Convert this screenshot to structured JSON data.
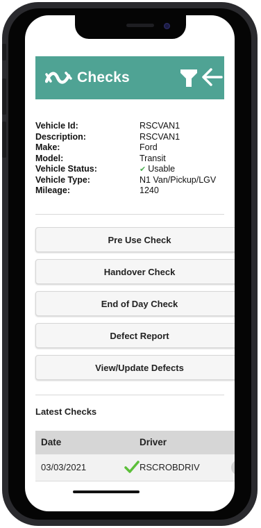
{
  "app": {
    "title": "Checks",
    "icons": {
      "logo": "wave-logo-icon",
      "filter": "filter-icon",
      "back": "back-arrow-icon"
    }
  },
  "vehicle": {
    "rows": [
      {
        "label": "Vehicle Id:",
        "value": "RSCVAN1"
      },
      {
        "label": "Description:",
        "value": "RSCVAN1"
      },
      {
        "label": "Make:",
        "value": "Ford"
      },
      {
        "label": "Model:",
        "value": "Transit"
      },
      {
        "label": "Vehicle Status:",
        "value": "Usable",
        "status_icon": "check-icon"
      },
      {
        "label": "Vehicle Type:",
        "value": "N1 Van/Pickup/LGV"
      },
      {
        "label": "Mileage:",
        "value": "1240"
      }
    ]
  },
  "actions": {
    "pre_use": "Pre Use Check",
    "handover": "Handover Check",
    "end_of_day": "End of Day Check",
    "defect_report": "Defect Report",
    "view_update_defects": "View/Update Defects"
  },
  "latest_checks": {
    "heading": "Latest Checks",
    "columns": {
      "date": "Date",
      "driver": "Driver"
    },
    "rows": [
      {
        "date": "03/03/2021",
        "status_icon": "check-icon",
        "driver": "RSCROBDRIV"
      }
    ]
  },
  "colors": {
    "header": "#4fa394",
    "status_ok": "#4caf50",
    "accent_check": "#5cbf3a"
  }
}
